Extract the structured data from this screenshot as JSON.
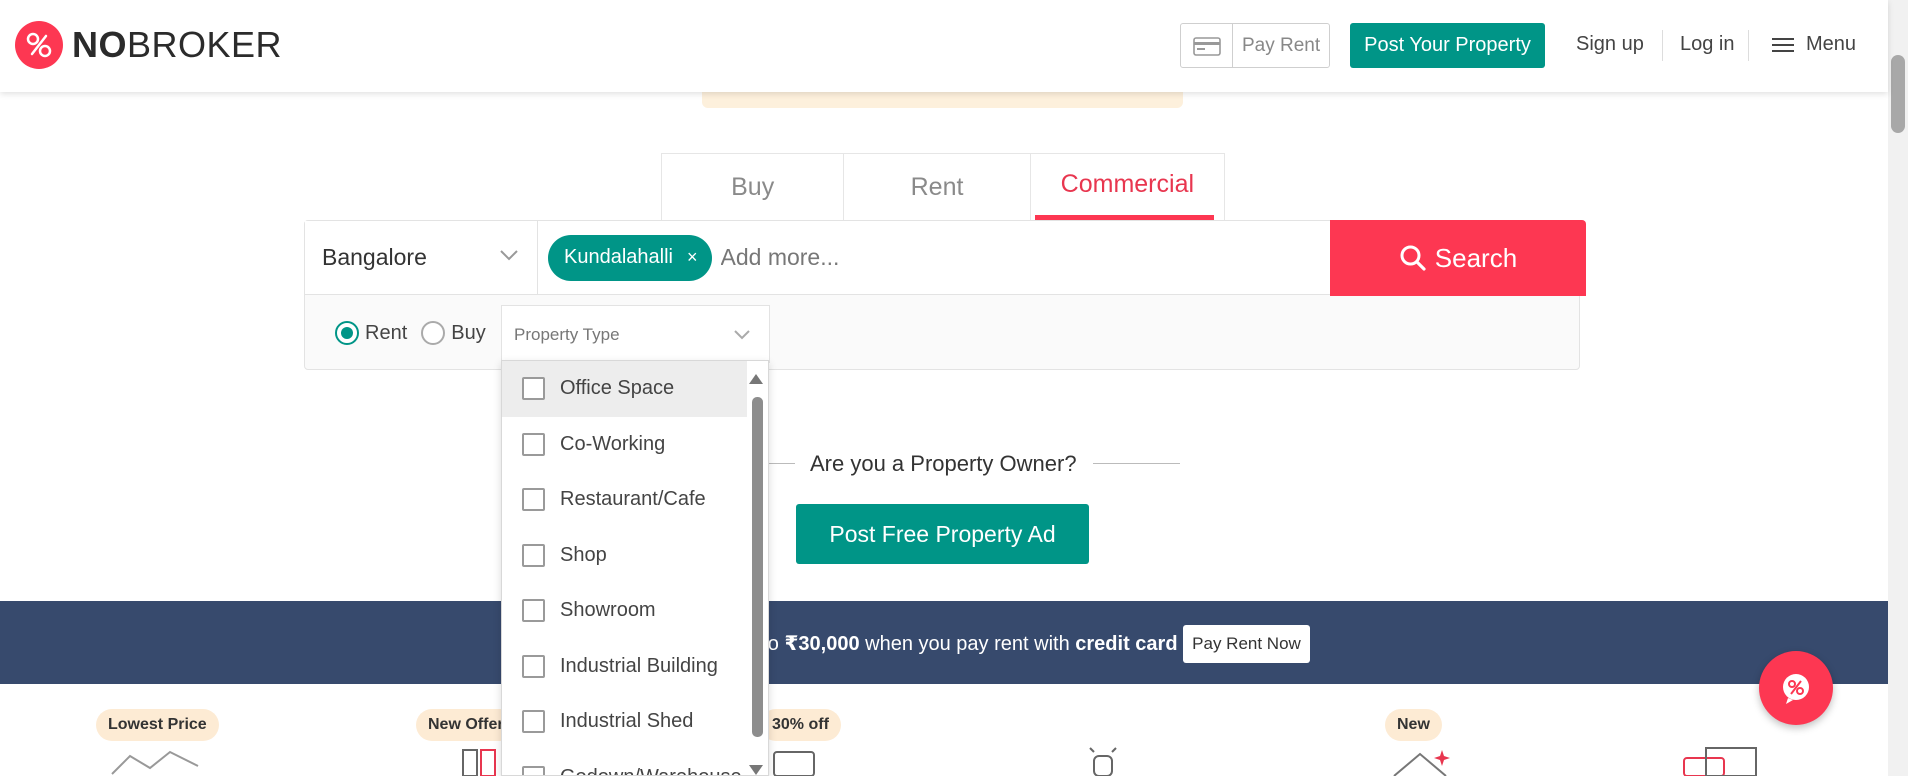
{
  "header": {
    "logo_bold": "NO",
    "logo_light": "BROKER",
    "pay_rent_label": "Pay Rent",
    "post_property_label": "Post Your Property",
    "signup_label": "Sign up",
    "login_label": "Log in",
    "menu_label": "Menu"
  },
  "tabs": [
    {
      "label": "Buy",
      "active": false
    },
    {
      "label": "Rent",
      "active": false
    },
    {
      "label": "Commercial",
      "active": true
    }
  ],
  "search": {
    "city": "Bangalore",
    "locality_chip": "Kundalahalli",
    "chip_remove": "×",
    "placeholder": "Add more...",
    "button_label": "Search"
  },
  "filters": {
    "rent_label": "Rent",
    "buy_label": "Buy",
    "selected_mode": "Rent",
    "property_type_placeholder": "Property Type"
  },
  "property_types": [
    {
      "label": "Office Space",
      "checked": false
    },
    {
      "label": "Co-Working",
      "checked": false
    },
    {
      "label": "Restaurant/Cafe",
      "checked": false
    },
    {
      "label": "Shop",
      "checked": false
    },
    {
      "label": "Showroom",
      "checked": false
    },
    {
      "label": "Industrial Building",
      "checked": false
    },
    {
      "label": "Industrial Shed",
      "checked": false
    },
    {
      "label": "Godown/Warehouse",
      "checked": false
    }
  ],
  "owner": {
    "question": "Are you a Property Owner?",
    "button_label": "Post Free Property Ad"
  },
  "promo": {
    "text_pre": "upto ",
    "amount": "₹30,000",
    "text_mid": " when you pay rent with ",
    "text_bold": "credit card",
    "button_label": "Pay Rent Now"
  },
  "service_badges": [
    "Lowest Price",
    "New Offer",
    "30% off",
    "New"
  ],
  "colors": {
    "brand_red": "#fd3752",
    "brand_teal": "#009587",
    "promo_bg": "#374a6d",
    "badge_bg": "#fdebd4"
  }
}
